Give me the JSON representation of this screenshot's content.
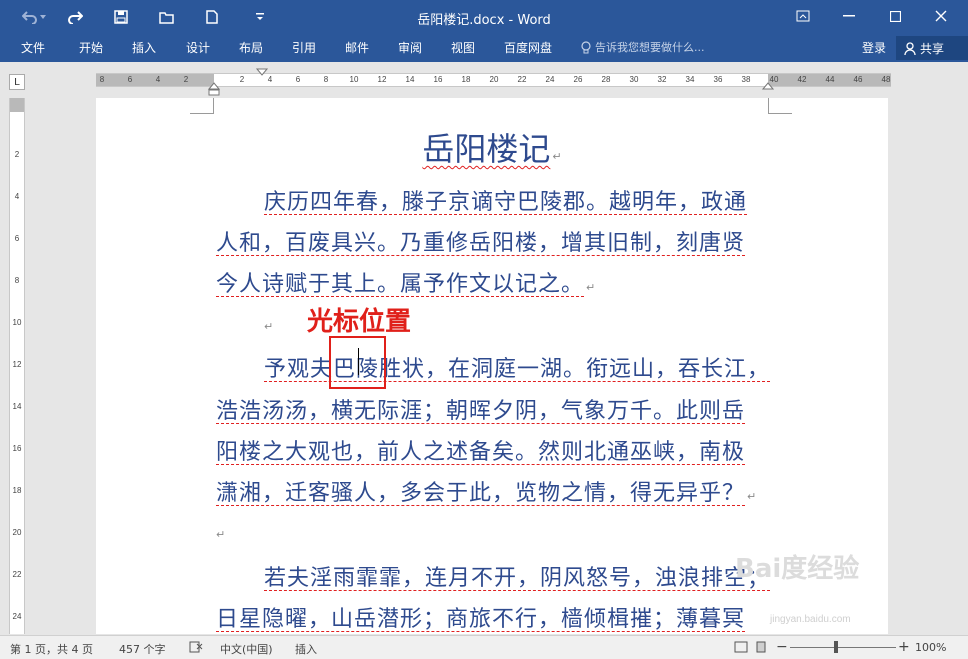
{
  "window": {
    "title": "岳阳楼记.docx - Word"
  },
  "ribbon": {
    "tabs": [
      "文件",
      "开始",
      "插入",
      "设计",
      "布局",
      "引用",
      "邮件",
      "审阅",
      "视图",
      "百度网盘"
    ],
    "tell_me": "告诉我您想要做什么...",
    "login": "登录",
    "share": "共享"
  },
  "ruler": {
    "h_labels": [
      "8",
      "6",
      "4",
      "2",
      "2",
      "4",
      "6",
      "8",
      "10",
      "12",
      "14",
      "16",
      "18",
      "20",
      "22",
      "24",
      "26",
      "28",
      "30",
      "32",
      "34",
      "36",
      "38",
      "40",
      "42",
      "44",
      "46",
      "48"
    ],
    "v_labels": [
      "2",
      "4",
      "6",
      "8",
      "10",
      "12",
      "14",
      "16",
      "18",
      "20",
      "22",
      "24"
    ]
  },
  "document": {
    "title": "岳阳楼记",
    "lines": [
      "庆历四年春，滕子京谪守巴陵郡。越明年，政通",
      "人和，百废具兴。乃重修岳阳楼，增其旧制，刻唐贤",
      "今人诗赋于其上。属予作文以记之。",
      "予观夫巴陵胜状，在洞庭一湖。衔远山，吞长江，",
      "浩浩汤汤，横无际涯；朝晖夕阴，气象万千。此则岳",
      "阳楼之大观也，前人之述备矣。然则北通巫峡，南极",
      "潇湘，迁客骚人，多会于此，览物之情，得无异乎？",
      "若夫淫雨霏霏，连月不开，阴风怒号，浊浪排空；",
      "日星隐曜，山岳潜形；商旅不行，樯倾楫摧；薄暮冥"
    ],
    "paragraph_mark": "↵"
  },
  "annotation": {
    "label": "光标位置"
  },
  "watermark": {
    "text": "Bai度经验",
    "url": "jingyan.baidu.com"
  },
  "status": {
    "page": "第 1 页，共 4 页",
    "words": "457 个字",
    "language": "中文(中国)",
    "mode": "插入",
    "zoom": "100%"
  },
  "colors": {
    "ribbon": "#2b579a",
    "text": "#2e4a8e",
    "annotation": "#e0201a"
  }
}
